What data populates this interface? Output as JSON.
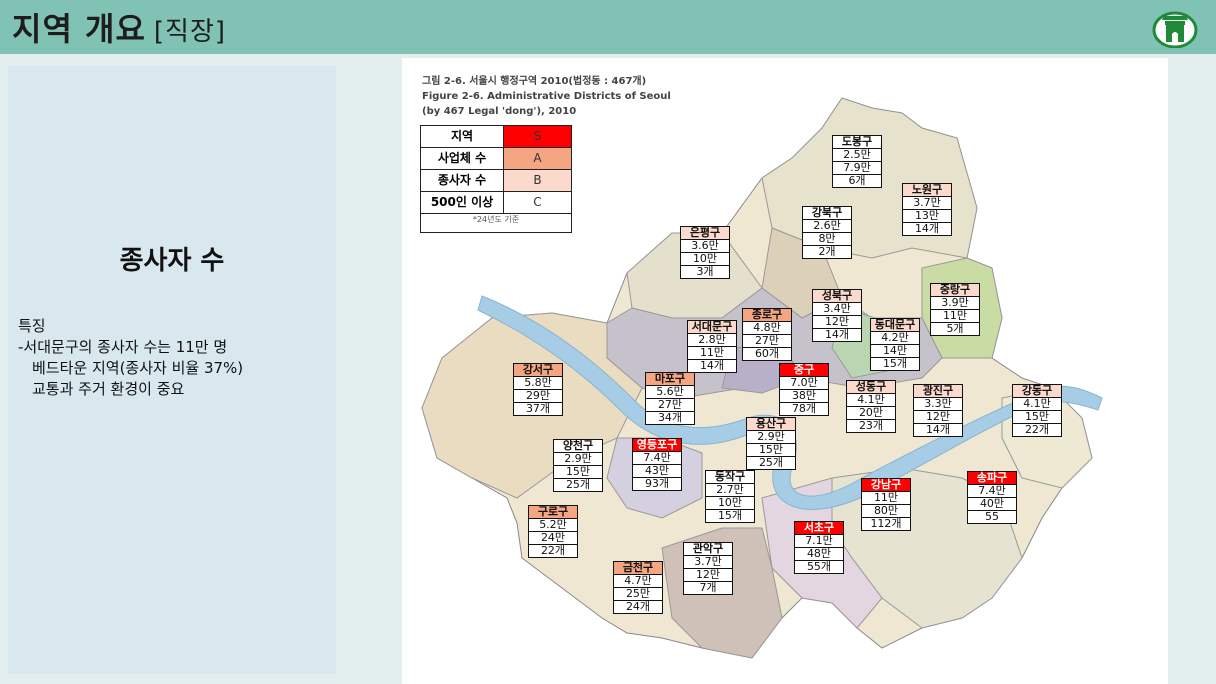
{
  "header": {
    "title": "지역 개요",
    "title_bracket": "[직장]",
    "logo": "seoul-gate-logo"
  },
  "left_panel": {
    "heading": "종사자 수",
    "feature_label": "특징",
    "feature_line1": "-서대문구의 종사자 수는 11만 명",
    "feature_line2": "베드타운 지역(종사자 비율 37%)",
    "feature_line3": "교통과 주거 환경이 중요"
  },
  "map": {
    "caption_line1": "그림 2-6. 서울시 행정구역 2010(법정동 : 467개)",
    "caption_line2": "Figure 2-6. Administrative Districts of Seoul",
    "caption_line3": "(by 467 Legal 'dong'), 2010",
    "legend": {
      "rows": [
        {
          "label": "지역",
          "code": "S",
          "color": "#ff0000"
        },
        {
          "label": "사업체 수",
          "code": "A",
          "color": "#f4a582"
        },
        {
          "label": "종사자 수",
          "code": "B",
          "color": "#fbd9cc"
        },
        {
          "label": "500인 이상",
          "code": "C",
          "color": "#ffffff"
        }
      ],
      "note": "*24년도 기준"
    },
    "colors": {
      "river": "#a7cde6",
      "S": "#ff0000",
      "A": "#f4a582",
      "B": "#fbd9cc",
      "C": "#ffffff"
    },
    "districts": [
      {
        "name": "도봉구",
        "workers": "2.5만",
        "businesses": "7.9만",
        "large": "6개",
        "level": "C"
      },
      {
        "name": "노원구",
        "workers": "3.7만",
        "businesses": "13만",
        "large": "14개",
        "level": "B"
      },
      {
        "name": "강북구",
        "workers": "2.6만",
        "businesses": "8만",
        "large": "2개",
        "level": "C"
      },
      {
        "name": "은평구",
        "workers": "3.6만",
        "businesses": "10만",
        "large": "3개",
        "level": "B"
      },
      {
        "name": "중랑구",
        "workers": "3.9만",
        "businesses": "11만",
        "large": "5개",
        "level": "B"
      },
      {
        "name": "성북구",
        "workers": "3.4만",
        "businesses": "12만",
        "large": "14개",
        "level": "B"
      },
      {
        "name": "종로구",
        "workers": "4.8만",
        "businesses": "27만",
        "large": "60개",
        "level": "A"
      },
      {
        "name": "서대문구",
        "workers": "2.8만",
        "businesses": "11만",
        "large": "14개",
        "level": "B"
      },
      {
        "name": "동대문구",
        "workers": "4.2만",
        "businesses": "14만",
        "large": "15개",
        "level": "B"
      },
      {
        "name": "강서구",
        "workers": "5.8만",
        "businesses": "29만",
        "large": "37개",
        "level": "A"
      },
      {
        "name": "마포구",
        "workers": "5.6만",
        "businesses": "27만",
        "large": "34개",
        "level": "A"
      },
      {
        "name": "중구",
        "workers": "7.0만",
        "businesses": "38만",
        "large": "78개",
        "level": "S"
      },
      {
        "name": "성동구",
        "workers": "4.1만",
        "businesses": "20만",
        "large": "23개",
        "level": "B"
      },
      {
        "name": "광진구",
        "workers": "3.3만",
        "businesses": "12만",
        "large": "14개",
        "level": "B"
      },
      {
        "name": "강동구",
        "workers": "4.1만",
        "businesses": "15만",
        "large": "22개",
        "level": "B"
      },
      {
        "name": "용산구",
        "workers": "2.9만",
        "businesses": "15만",
        "large": "25개",
        "level": "B"
      },
      {
        "name": "양천구",
        "workers": "2.9만",
        "businesses": "15만",
        "large": "25개",
        "level": "C"
      },
      {
        "name": "영등포구",
        "workers": "7.4만",
        "businesses": "43만",
        "large": "93개",
        "level": "S"
      },
      {
        "name": "동작구",
        "workers": "2.7만",
        "businesses": "10만",
        "large": "15개",
        "level": "C"
      },
      {
        "name": "강남구",
        "workers": "11만",
        "businesses": "80만",
        "large": "112개",
        "level": "S"
      },
      {
        "name": "송파구",
        "workers": "7.4만",
        "businesses": "40만",
        "large": "55",
        "level": "S"
      },
      {
        "name": "구로구",
        "workers": "5.2만",
        "businesses": "24만",
        "large": "22개",
        "level": "A"
      },
      {
        "name": "서초구",
        "workers": "7.1만",
        "businesses": "48만",
        "large": "55개",
        "level": "S"
      },
      {
        "name": "관악구",
        "workers": "3.7만",
        "businesses": "12만",
        "large": "7개",
        "level": "C"
      },
      {
        "name": "금천구",
        "workers": "4.7만",
        "businesses": "25만",
        "large": "24개",
        "level": "A"
      }
    ]
  }
}
